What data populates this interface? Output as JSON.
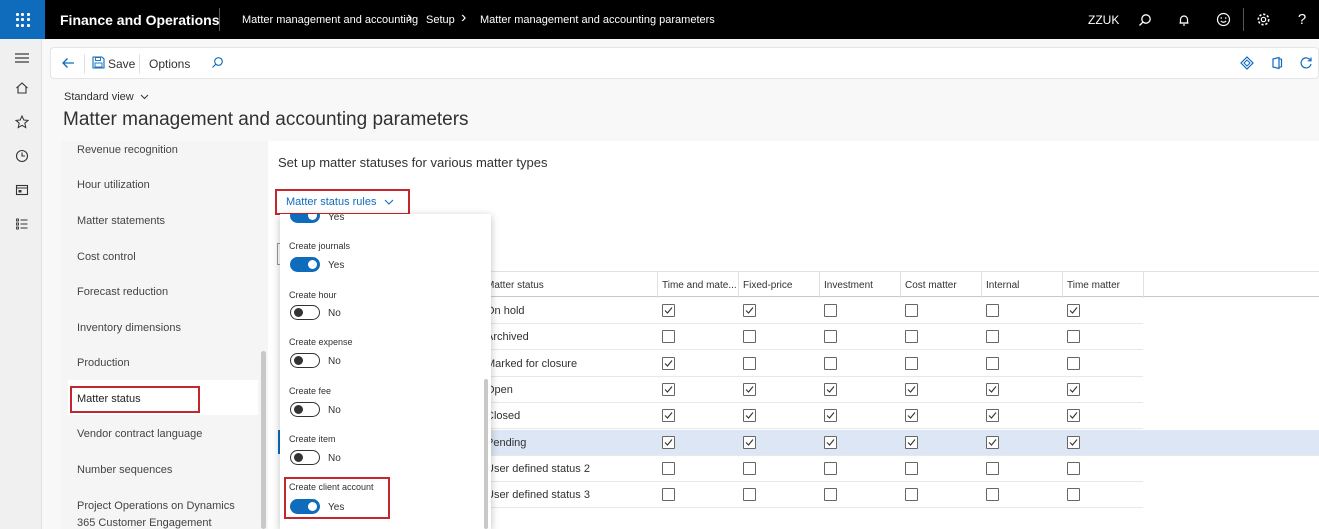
{
  "topbar": {
    "app_name": "Finance and Operations",
    "breadcrumb": [
      "Matter management and accounting",
      "Setup",
      "Matter management and accounting parameters"
    ],
    "company": "ZZUK"
  },
  "actionbar": {
    "save_label": "Save",
    "options_label": "Options"
  },
  "page": {
    "view_label": "Standard view",
    "title": "Matter management and accounting parameters"
  },
  "left_nav": {
    "items": [
      "Revenue recognition",
      "Hour utilization",
      "Matter statements",
      "Cost control",
      "Forecast reduction",
      "Inventory dimensions",
      "Production",
      "Matter status",
      "Vendor contract language",
      "Number sequences",
      "Project Operations on Dynamics 365 Customer Engagement"
    ],
    "selected": "Matter status"
  },
  "section": {
    "title": "Set up matter statuses for various matter types",
    "menu_button": "Matter status rules"
  },
  "dropdown": {
    "partial_top_value": "Yes",
    "toggles": [
      {
        "label": "Create journals",
        "value": "Yes",
        "on": true
      },
      {
        "label": "Create hour",
        "value": "No",
        "on": false
      },
      {
        "label": "Create expense",
        "value": "No",
        "on": false
      },
      {
        "label": "Create fee",
        "value": "No",
        "on": false
      },
      {
        "label": "Create item",
        "value": "No",
        "on": false
      },
      {
        "label": "Create client account",
        "value": "Yes",
        "on": true
      }
    ]
  },
  "grid": {
    "columns": [
      "Matter status",
      "Time and mate...",
      "Fixed-price",
      "Investment",
      "Cost matter",
      "Internal",
      "Time matter"
    ],
    "rows": [
      {
        "status": "On hold",
        "values": [
          true,
          true,
          false,
          false,
          false,
          true
        ],
        "selected": false
      },
      {
        "status": "Archived",
        "values": [
          false,
          false,
          false,
          false,
          false,
          false
        ],
        "selected": false
      },
      {
        "status": "Marked for closure",
        "values": [
          true,
          false,
          false,
          false,
          false,
          false
        ],
        "selected": false
      },
      {
        "status": "Open",
        "values": [
          true,
          true,
          true,
          true,
          true,
          true
        ],
        "selected": false
      },
      {
        "status": "Closed",
        "values": [
          true,
          true,
          true,
          true,
          true,
          true
        ],
        "selected": false
      },
      {
        "status": "Pending",
        "values": [
          true,
          true,
          true,
          true,
          true,
          true
        ],
        "selected": true
      },
      {
        "status": "User defined status 2",
        "values": [
          false,
          false,
          false,
          false,
          false,
          false
        ],
        "selected": false
      },
      {
        "status": "User defined status 3",
        "values": [
          false,
          false,
          false,
          false,
          false,
          false
        ],
        "selected": false
      }
    ]
  },
  "colors": {
    "brand_blue": "#0f6cbd",
    "highlight_red": "#c4262e",
    "selected_row": "#dce6f4"
  }
}
